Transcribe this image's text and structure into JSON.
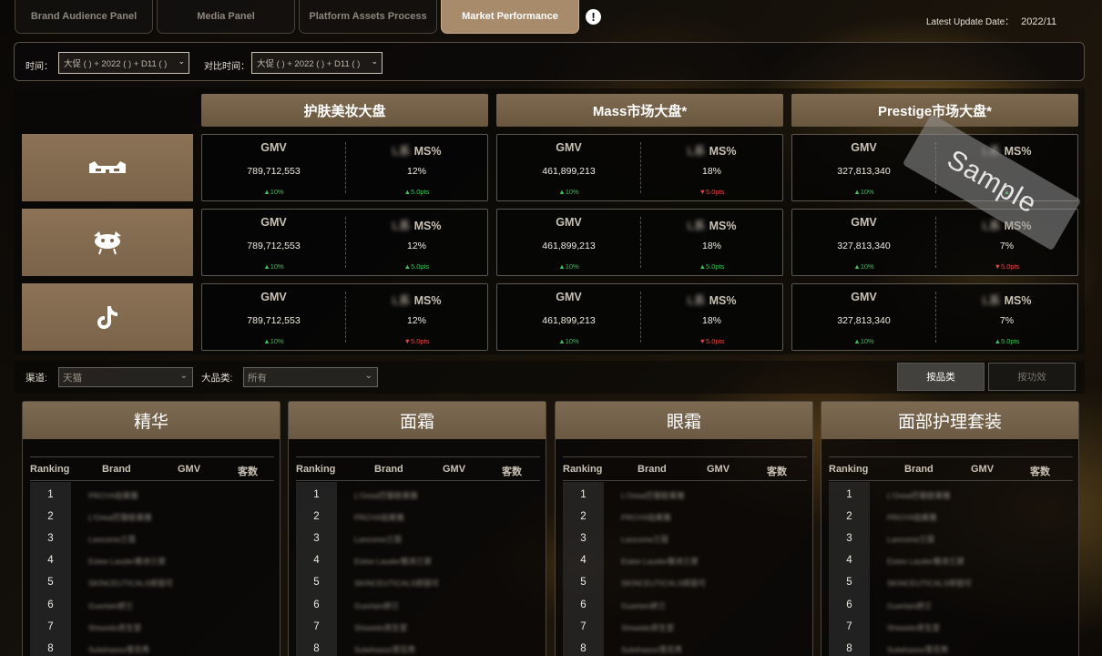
{
  "tabs": [
    {
      "label": "Brand Audience Panel",
      "active": false
    },
    {
      "label": "Media Panel",
      "active": false
    },
    {
      "label": "Platform Assets Process",
      "active": false
    },
    {
      "label": "Market Performance",
      "active": true
    }
  ],
  "update": {
    "label": "Latest Update Date：",
    "date": "2022/11"
  },
  "filters": {
    "time_label": "时间：",
    "time_value": "大促 ( ) + 2022 ( ) + D11 ( )",
    "compare_label": "对比时间：",
    "compare_value": "大促 ( ) + 2022 ( ) + D11 ( )"
  },
  "columns": [
    "护肤美妆大盘",
    "Mass市场大盘*",
    "Prestige市场大盘*"
  ],
  "platforms": [
    {
      "name": "tmall-icon"
    },
    {
      "name": "jd-icon"
    },
    {
      "name": "tiktok-icon"
    }
  ],
  "kpi": {
    "gmv_label": "GMV",
    "ms_label": "MS%",
    "ms_blur": "L系",
    "rows": [
      [
        {
          "gmv": "789,712,553",
          "gmv_chg": "10%",
          "gmv_dir": "up",
          "ms": "12%",
          "ms_chg": "5.0pts",
          "ms_dir": "up"
        },
        {
          "gmv": "461,899,213",
          "gmv_chg": "10%",
          "gmv_dir": "up",
          "ms": "18%",
          "ms_chg": "5.0pts",
          "ms_dir": "down"
        },
        {
          "gmv": "327,813,340",
          "gmv_chg": "10%",
          "gmv_dir": "up",
          "ms": "",
          "ms_chg": "",
          "ms_dir": "up"
        }
      ],
      [
        {
          "gmv": "789,712,553",
          "gmv_chg": "10%",
          "gmv_dir": "up",
          "ms": "12%",
          "ms_chg": "5.0pts",
          "ms_dir": "up"
        },
        {
          "gmv": "461,899,213",
          "gmv_chg": "10%",
          "gmv_dir": "up",
          "ms": "18%",
          "ms_chg": "5.0pts",
          "ms_dir": "up"
        },
        {
          "gmv": "327,813,340",
          "gmv_chg": "10%",
          "gmv_dir": "up",
          "ms": "7%",
          "ms_chg": "5.0pts",
          "ms_dir": "down"
        }
      ],
      [
        {
          "gmv": "789,712,553",
          "gmv_chg": "10%",
          "gmv_dir": "up",
          "ms": "12%",
          "ms_chg": "5.0pts",
          "ms_dir": "down"
        },
        {
          "gmv": "461,899,213",
          "gmv_chg": "10%",
          "gmv_dir": "up",
          "ms": "18%",
          "ms_chg": "5.0pts",
          "ms_dir": "down"
        },
        {
          "gmv": "327,813,340",
          "gmv_chg": "10%",
          "gmv_dir": "up",
          "ms": "7%",
          "ms_chg": "5.0pts",
          "ms_dir": "up"
        }
      ]
    ]
  },
  "watermark": "Sample",
  "filters2": {
    "channel_label": "渠道:",
    "channel_value": "天猫",
    "category_label": "大品类:",
    "category_value": "所有",
    "btn_by_category": "按品类",
    "btn_by_efficacy": "按功效"
  },
  "table_headers": {
    "ranking": "Ranking",
    "brand": "Brand",
    "gmv": "GMV",
    "customers": "客数"
  },
  "categories": [
    {
      "title": "精华",
      "brands": [
        "PROYA珀莱雅",
        "L'Oréal巴黎欧莱雅",
        "Lancome兰蔻",
        "Estee Lauder雅诗兰黛",
        "SKINCEUTICALS修丽可",
        "Guerlain娇兰",
        "Shiseido资生堂",
        "Sulwhasoo雪花秀"
      ]
    },
    {
      "title": "面霜",
      "brands": [
        "L'Oréal巴黎欧莱雅",
        "PROYA珀莱雅",
        "Lancome兰蔻",
        "Estee Lauder雅诗兰黛",
        "SKINCEUTICALS修丽可",
        "Guerlain娇兰",
        "Shiseido资生堂",
        "Sulwhasoo雪花秀"
      ]
    },
    {
      "title": "眼霜",
      "brands": [
        "L'Oréal巴黎欧莱雅",
        "PROYA珀莱雅",
        "Lancome兰蔻",
        "Estee Lauder雅诗兰黛",
        "SKINCEUTICALS修丽可",
        "Guerlain娇兰",
        "Shiseido资生堂",
        "Sulwhasoo雪花秀"
      ]
    },
    {
      "title": "面部护理套装",
      "brands": [
        "L'Oréal巴黎欧莱雅",
        "PROYA珀莱雅",
        "Lancome兰蔻",
        "Estee Lauder雅诗兰黛",
        "SKINCEUTICALS修丽可",
        "Guerlain娇兰",
        "Shiseido资生堂",
        "Sulwhasoo雪花秀"
      ]
    }
  ],
  "colors": {
    "accent": "#a88b6a",
    "up": "#3fbf5a",
    "down": "#e04848"
  }
}
